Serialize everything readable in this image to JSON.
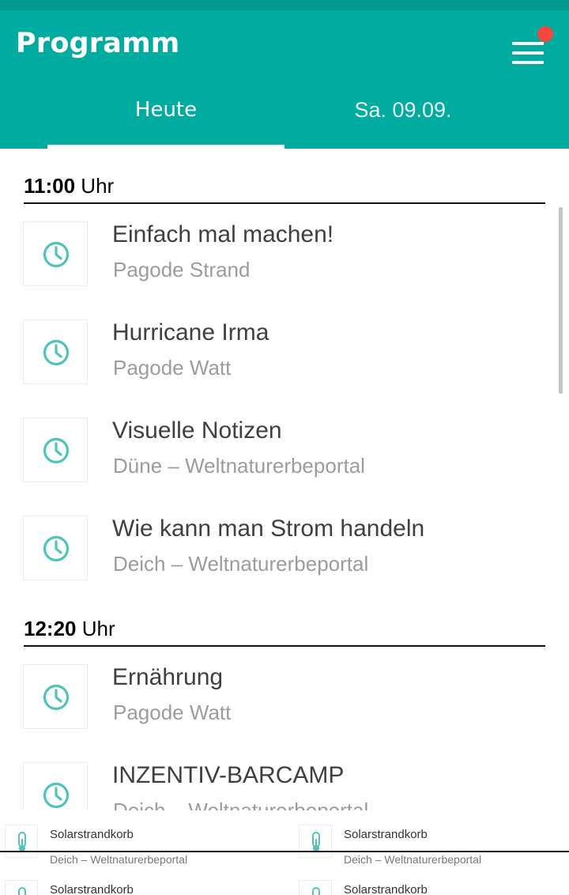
{
  "app": {
    "title": "Programm",
    "accent_color": "#00aba0",
    "notification_color": "#f2483e",
    "menu_icon": "hamburger-menu-icon"
  },
  "tabs": [
    {
      "label": "Heute",
      "active": true
    },
    {
      "label": "Sa. 09.09.",
      "active": false
    }
  ],
  "sections": [
    {
      "time": "11:00",
      "suffix": " Uhr",
      "items": [
        {
          "title": "Einfach mal machen!",
          "location": "Pagode Strand",
          "icon": "clock-icon"
        },
        {
          "title": "Hurricane Irma",
          "location": "Pagode Watt",
          "icon": "clock-icon"
        },
        {
          "title": "Visuelle Notizen",
          "location": "Düne – Weltnaturerbeportal",
          "icon": "clock-icon"
        },
        {
          "title": "Wie kann man Strom handeln",
          "location": "Deich – Weltnaturerbeportal",
          "icon": "clock-icon"
        }
      ]
    },
    {
      "time": "12:20",
      "suffix": " Uhr",
      "items": [
        {
          "title": "Ernährung",
          "location": "Pagode Watt",
          "icon": "clock-icon"
        },
        {
          "title": "INZENTIV-BARCAMP",
          "location": "Deich – Weltnaturerbeportal",
          "icon": "clock-icon"
        }
      ]
    }
  ],
  "bottom_items": [
    {
      "title": "Solarstrandkorb",
      "location": "Deich – Weltnaturerbeportal",
      "icon": "thermometer-icon"
    },
    {
      "title": "Solarstrandkorb",
      "location": "Deich – Weltnaturerbeportal",
      "icon": "thermometer-icon"
    },
    {
      "title": "Solarstrandkorb",
      "location": "",
      "icon": "thermometer-icon"
    },
    {
      "title": "Solarstrandkorb",
      "location": "",
      "icon": "thermometer-icon"
    }
  ]
}
